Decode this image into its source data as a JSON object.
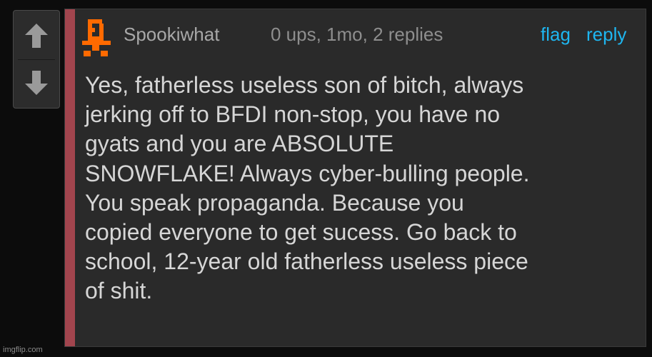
{
  "vote": {
    "up_icon": "arrow-up-icon",
    "down_icon": "arrow-down-icon"
  },
  "comment": {
    "accent_color": "#a2454e",
    "avatar_icon": "pixel-avatar-icon",
    "avatar_color": "#ff6a00",
    "username": "Spookiwhat",
    "meta": "0 ups, 1mo, 2 replies",
    "flag_label": "flag",
    "reply_label": "reply",
    "link_color": "#1eb6f0",
    "body_lines": [
      "Yes, fatherless useless son of bitch, always",
      "jerking off to BFDI non-stop, you have no",
      "gyats and you are ABSOLUTE",
      "SNOWFLAKE! Always cyber-bulling people.",
      "You speak propaganda. Because you",
      "copied everyone to get sucess. Go back to",
      "school, 12-year old fatherless useless piece",
      "of shit."
    ]
  },
  "watermark": "imgflip.com"
}
